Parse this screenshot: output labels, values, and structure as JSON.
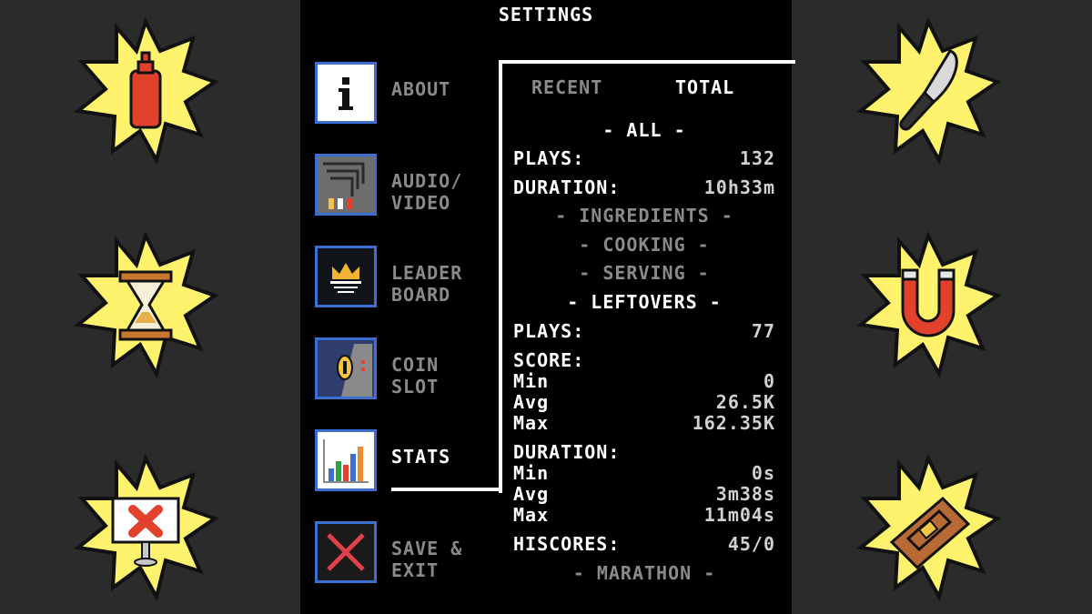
{
  "window": {
    "title": "SETTINGS"
  },
  "colors": {
    "accent": "#3b6fd1",
    "burst": "#fff36e",
    "panel_bg": "#000000",
    "side_bg": "#2b2b2b"
  },
  "decorations": [
    "ketchup-bottle-icon",
    "hourglass-icon",
    "sign-x-icon",
    "knife-icon",
    "magnet-icon",
    "mousetrap-icon"
  ],
  "menu": [
    {
      "label": "ABOUT",
      "icon": "info-icon",
      "active": false
    },
    {
      "label": "AUDIO/\nVIDEO",
      "icon": "cables-icon",
      "active": false
    },
    {
      "label": "LEADER\nBOARD",
      "icon": "crown-icon",
      "active": false
    },
    {
      "label": "COIN\nSLOT",
      "icon": "coin-slot-icon",
      "active": false
    },
    {
      "label": "STATS",
      "icon": "bar-chart-icon",
      "active": true
    },
    {
      "label": "SAVE &\nEXIT",
      "icon": "close-x-icon",
      "active": false
    }
  ],
  "tabs": {
    "recent": "RECENT",
    "total": "TOTAL"
  },
  "stats": {
    "all_header": "- ALL -",
    "all_plays_label": "PLAYS:",
    "all_plays_value": "132",
    "all_duration_label": "DURATION:",
    "all_duration_value": "10h33m",
    "ingredients": "- INGREDIENTS -",
    "cooking": "- COOKING -",
    "serving": "- SERVING -",
    "leftovers_header": "- LEFTOVERS -",
    "lo_plays_label": "PLAYS:",
    "lo_plays_value": "77",
    "score_label": "SCORE:",
    "score_min_label": "Min",
    "score_min_value": "0",
    "score_avg_label": "Avg",
    "score_avg_value": "26.5K",
    "score_max_label": "Max",
    "score_max_value": "162.35K",
    "duration_label": "DURATION:",
    "dur_min_label": "Min",
    "dur_min_value": "0s",
    "dur_avg_label": "Avg",
    "dur_avg_value": "3m38s",
    "dur_max_label": "Max",
    "dur_max_value": "11m04s",
    "hiscores_label": "HISCORES:",
    "hiscores_value": "45/0",
    "marathon": "- MARATHON -"
  }
}
